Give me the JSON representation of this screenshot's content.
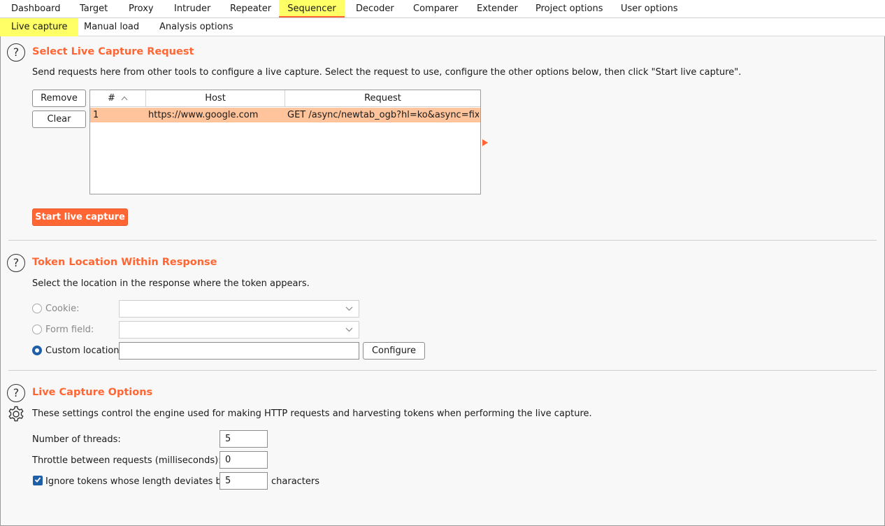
{
  "top_tabs": [
    "Dashboard",
    "Target",
    "Proxy",
    "Intruder",
    "Repeater",
    "Sequencer",
    "Decoder",
    "Comparer",
    "Extender",
    "Project options",
    "User options"
  ],
  "active_top_tab": "Sequencer",
  "sub_tabs": [
    "Live capture",
    "Manual load",
    "Analysis options"
  ],
  "active_sub_tab": "Live capture",
  "select_request": {
    "title": "Select Live Capture Request",
    "description": "Send requests here from other tools to configure a live capture. Select the request to use, configure the other options below, then click \"Start live capture\".",
    "remove_label": "Remove",
    "clear_label": "Clear",
    "columns": [
      "#",
      "Host",
      "Request"
    ],
    "sort_indicator": "^",
    "rows": [
      {
        "num": "1",
        "host": "https://www.google.com",
        "request": "GET /async/newtab_ogb?hl=ko&async=fixe..."
      }
    ],
    "start_label": "Start live capture"
  },
  "token_location": {
    "title": "Token Location Within Response",
    "description": "Select the location in the response where the token appears.",
    "cookie_label": "Cookie:",
    "form_field_label": "Form field:",
    "custom_label": "Custom location:",
    "custom_value": "",
    "configure_label": "Configure",
    "selected": "custom"
  },
  "capture_options": {
    "title": "Live Capture Options",
    "description": "These settings control the engine used for making HTTP requests and harvesting tokens when performing the live capture.",
    "threads_label": "Number of threads:",
    "threads_value": "5",
    "throttle_label": "Throttle between requests (milliseconds):",
    "throttle_value": "0",
    "ignore_label": "Ignore tokens whose length deviates by",
    "ignore_value": "5",
    "ignore_suffix": "characters",
    "ignore_checked": true
  },
  "colors": {
    "accent": "#ff6633",
    "highlight": "#ffff66",
    "row_selected": "#ffc49b",
    "radio_checked": "#1f5fa8"
  },
  "icons": [
    "help-icon",
    "gear-icon",
    "sort-up-icon",
    "chevron-down-icon",
    "check-icon",
    "arrow-right-icon"
  ]
}
